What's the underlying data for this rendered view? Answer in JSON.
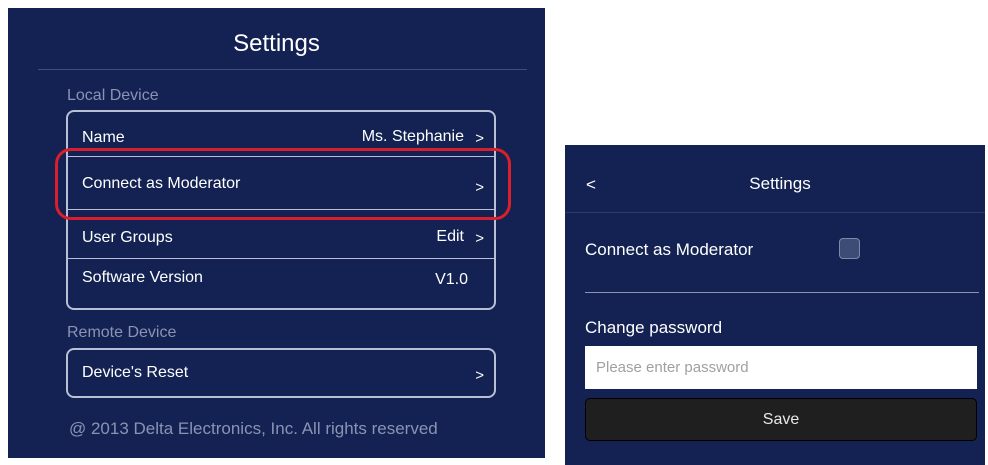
{
  "left_panel": {
    "title": "Settings",
    "local_device_label": "Local Device",
    "local_rows": [
      {
        "label": "Name",
        "value": "Ms. Stephanie",
        "chevron": ">"
      },
      {
        "label": "Connect as Moderator",
        "value": "",
        "chevron": ">"
      },
      {
        "label": "User Groups",
        "value": "Edit",
        "chevron": ">"
      },
      {
        "label": "Software Version",
        "value": "V1.0"
      }
    ],
    "remote_device_label": "Remote Device",
    "remote_rows": [
      {
        "label": "Device's Reset",
        "chevron": ">"
      }
    ],
    "footer": "@ 2013 Delta Electronics, Inc. All rights reserved"
  },
  "right_panel": {
    "back": "<",
    "title": "Settings",
    "connect_moderator_label": "Connect as Moderator",
    "connect_moderator_checked": false,
    "change_password_label": "Change password",
    "password_placeholder": "Please enter password",
    "password_value": "",
    "save_label": "Save"
  },
  "colors": {
    "panel_background": "#132252",
    "highlight": "#d91f2b",
    "muted_text": "#8a93b4"
  }
}
